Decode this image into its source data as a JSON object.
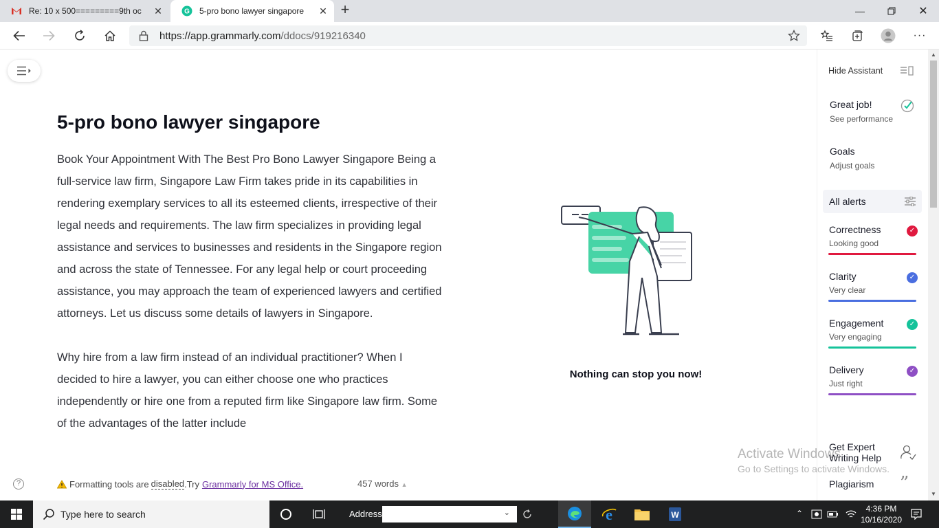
{
  "browser": {
    "tabs": [
      {
        "title": "Re: 10 x 500=========9th oc",
        "icon": "gmail-icon",
        "active": false
      },
      {
        "title": "5-pro bono lawyer singapore",
        "icon": "grammarly-icon",
        "active": true
      }
    ],
    "url_host": "https://app.grammarly.com",
    "url_path": "/ddocs/919216340"
  },
  "document": {
    "title": "5-pro bono lawyer singapore",
    "paragraphs": [
      "Book Your Appointment With The Best Pro Bono Lawyer Singapore Being a full-service law firm, Singapore Law Firm takes pride in its capabilities in rendering exemplary services to all its esteemed clients, irrespective of their legal needs and requirements. The law firm specializes in providing legal assistance and services to businesses and residents in the Singapore region and across the state of Tennessee. For any legal help or court proceeding assistance, you may approach the team of experienced lawyers and certified attorneys. Let us discuss some details of lawyers in Singapore.",
      "Why hire from a law firm instead of an individual practitioner? When I decided to hire a lawyer, you can either choose one who practices independently or hire one from a reputed firm like Singapore law firm. Some of the advantages of the latter include"
    ]
  },
  "illustration": {
    "caption": "Nothing can stop you now!"
  },
  "bottom_bar": {
    "notice_prefix": "Formatting tools are",
    "notice_disabled": "disabled",
    "notice_try": ".Try",
    "notice_link": "Grammarly for MS Office.",
    "word_count": "457 words"
  },
  "assistant": {
    "hide_label": "Hide Assistant",
    "performance_title": "Great job!",
    "performance_sub": "See performance",
    "goals_title": "Goals",
    "goals_sub": "Adjust goals",
    "all_alerts": "All alerts",
    "categories": [
      {
        "name": "Correctness",
        "status": "Looking good",
        "color": "#e0193f"
      },
      {
        "name": "Clarity",
        "status": "Very clear",
        "color": "#4a6ee0"
      },
      {
        "name": "Engagement",
        "status": "Very engaging",
        "color": "#15c39a"
      },
      {
        "name": "Delivery",
        "status": "Just right",
        "color": "#8e4fc4"
      }
    ],
    "expert_help": "Get Expert Writing Help",
    "plagiarism": "Plagiarism"
  },
  "watermark": {
    "line1": "Activate Windows",
    "line2": "Go to Settings to activate Windows."
  },
  "taskbar": {
    "search_placeholder": "Type here to search",
    "address_label": "Address",
    "time": "4:36 PM",
    "date": "10/16/2020"
  }
}
